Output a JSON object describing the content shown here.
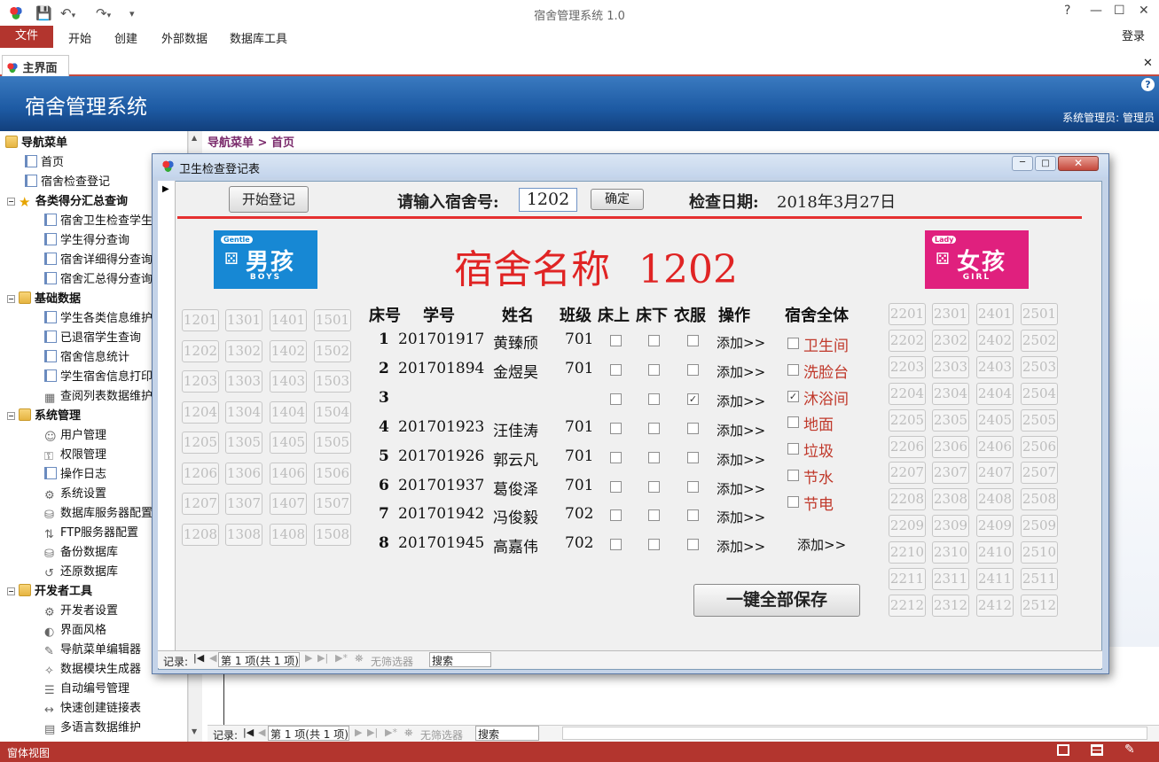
{
  "app": {
    "title": "宿舍管理系统 1.0",
    "login": "登录",
    "accent_color": "#b3352e"
  },
  "ribbon": {
    "file_tab": "文件",
    "tabs": [
      "开始",
      "创建",
      "外部数据",
      "数据库工具"
    ]
  },
  "doc_tab": {
    "label": "主界面"
  },
  "banner": {
    "title": "宿舍管理系统",
    "user": "系统管理员: 管理员"
  },
  "nav": {
    "items": [
      {
        "label": "导航菜单",
        "kind": "root",
        "icon": "folder-icon"
      },
      {
        "label": "首页",
        "kind": "leaf",
        "icon": "page-icon"
      },
      {
        "label": "宿舍检查登记",
        "kind": "leaf",
        "icon": "page-icon"
      },
      {
        "label": "各类得分汇总查询",
        "kind": "group",
        "icon": "star-icon"
      },
      {
        "label": "宿舍卫生检查学生",
        "kind": "sub",
        "icon": "page-icon"
      },
      {
        "label": "学生得分查询",
        "kind": "sub",
        "icon": "page-icon"
      },
      {
        "label": "宿舍详细得分查询",
        "kind": "sub",
        "icon": "page-icon"
      },
      {
        "label": "宿舍汇总得分查询",
        "kind": "sub",
        "icon": "page-icon"
      },
      {
        "label": "基础数据",
        "kind": "group",
        "icon": "folder-icon"
      },
      {
        "label": "学生各类信息维护",
        "kind": "sub",
        "icon": "page-icon"
      },
      {
        "label": "已退宿学生查询",
        "kind": "sub",
        "icon": "page-icon"
      },
      {
        "label": "宿舍信息统计",
        "kind": "sub",
        "icon": "page-icon"
      },
      {
        "label": "学生宿舍信息打印",
        "kind": "sub",
        "icon": "page-icon"
      },
      {
        "label": "查阅列表数据维护",
        "kind": "sub",
        "icon": "table-icon"
      },
      {
        "label": "系统管理",
        "kind": "group",
        "icon": "folder-icon"
      },
      {
        "label": "用户管理",
        "kind": "sub",
        "icon": "users-icon"
      },
      {
        "label": "权限管理",
        "kind": "sub",
        "icon": "lock-icon"
      },
      {
        "label": "操作日志",
        "kind": "sub",
        "icon": "page-icon"
      },
      {
        "label": "系统设置",
        "kind": "sub",
        "icon": "settings-icon"
      },
      {
        "label": "数据库服务器配置",
        "kind": "sub",
        "icon": "database-icon"
      },
      {
        "label": "FTP服务器配置",
        "kind": "sub",
        "icon": "ftp-icon"
      },
      {
        "label": "备份数据库",
        "kind": "sub",
        "icon": "backup-icon"
      },
      {
        "label": "还原数据库",
        "kind": "sub",
        "icon": "restore-icon"
      },
      {
        "label": "开发者工具",
        "kind": "group",
        "icon": "folder-icon"
      },
      {
        "label": "开发者设置",
        "kind": "sub",
        "icon": "dev-settings-icon"
      },
      {
        "label": "界面风格",
        "kind": "sub",
        "icon": "palette-icon"
      },
      {
        "label": "导航菜单编辑器",
        "kind": "sub",
        "icon": "edit-icon"
      },
      {
        "label": "数据模块生成器",
        "kind": "sub",
        "icon": "wand-icon"
      },
      {
        "label": "自动编号管理",
        "kind": "sub",
        "icon": "list-icon"
      },
      {
        "label": "快速创建链接表",
        "kind": "sub",
        "icon": "link-icon"
      },
      {
        "label": "多语言数据维护",
        "kind": "sub",
        "icon": "language-icon"
      }
    ]
  },
  "breadcrumb": "导航菜单 > 首页",
  "bottom_bar": {
    "record_label": "记录:",
    "position": "第 1 项(共 1 项)",
    "filter": "无筛选器",
    "search": "搜索"
  },
  "status": {
    "text": "窗体视图"
  },
  "dialog": {
    "title": "卫生检查登记表",
    "start_button": "开始登记",
    "dorm_prompt": "请输入宿舍号:",
    "dorm_value": "1202",
    "confirm_button": "确定",
    "date_label": "检查日期:",
    "date_value": "2018年3月27日",
    "heading_label": "宿舍名称",
    "heading_value": "1202",
    "boys_logo": {
      "main": "男孩",
      "sub": "BOYS",
      "tag": "Gentle"
    },
    "girls_logo": {
      "main": "女孩",
      "sub": "GIRL",
      "tag": "Lady"
    },
    "columns": [
      "床号",
      "学号",
      "姓名",
      "班级",
      "床上",
      "床下",
      "衣服",
      "操作"
    ],
    "whole_dorm_header": "宿舍全体",
    "rows": [
      {
        "bed": "1",
        "id": "201701917",
        "name": "黄臻颀",
        "class": "701",
        "bed_up": false,
        "bed_down": false,
        "clothes": false,
        "action": "添加>>"
      },
      {
        "bed": "2",
        "id": "201701894",
        "name": "金煜昊",
        "class": "701",
        "bed_up": false,
        "bed_down": false,
        "clothes": false,
        "action": "添加>>"
      },
      {
        "bed": "3",
        "id": "",
        "name": "",
        "class": "",
        "bed_up": false,
        "bed_down": false,
        "clothes": true,
        "action": "添加>>"
      },
      {
        "bed": "4",
        "id": "201701923",
        "name": "汪佳涛",
        "class": "701",
        "bed_up": false,
        "bed_down": false,
        "clothes": false,
        "action": "添加>>"
      },
      {
        "bed": "5",
        "id": "201701926",
        "name": "郭云凡",
        "class": "701",
        "bed_up": false,
        "bed_down": false,
        "clothes": false,
        "action": "添加>>"
      },
      {
        "bed": "6",
        "id": "201701937",
        "name": "葛俊泽",
        "class": "701",
        "bed_up": false,
        "bed_down": false,
        "clothes": false,
        "action": "添加>>"
      },
      {
        "bed": "7",
        "id": "201701942",
        "name": "冯俊毅",
        "class": "702",
        "bed_up": false,
        "bed_down": false,
        "clothes": false,
        "action": "添加>>"
      },
      {
        "bed": "8",
        "id": "201701945",
        "name": "高嘉伟",
        "class": "702",
        "bed_up": false,
        "bed_down": false,
        "clothes": false,
        "action": "添加>>"
      }
    ],
    "areas": [
      {
        "label": "卫生间",
        "checked": false
      },
      {
        "label": "洗脸台",
        "checked": false
      },
      {
        "label": "沐浴间",
        "checked": true
      },
      {
        "label": "地面",
        "checked": false
      },
      {
        "label": "垃圾",
        "checked": false
      },
      {
        "label": "节水",
        "checked": false
      },
      {
        "label": "节电",
        "checked": false
      }
    ],
    "areas_action": "添加>>",
    "save_button": "一键全部保存",
    "left_rooms": [
      [
        "1201",
        "1301",
        "1401",
        "1501"
      ],
      [
        "1202",
        "1302",
        "1402",
        "1502"
      ],
      [
        "1203",
        "1303",
        "1403",
        "1503"
      ],
      [
        "1204",
        "1304",
        "1404",
        "1504"
      ],
      [
        "1205",
        "1305",
        "1405",
        "1505"
      ],
      [
        "1206",
        "1306",
        "1406",
        "1506"
      ],
      [
        "1207",
        "1307",
        "1407",
        "1507"
      ],
      [
        "1208",
        "1308",
        "1408",
        "1508"
      ]
    ],
    "right_rooms": [
      [
        "2201",
        "2301",
        "2401",
        "2501"
      ],
      [
        "2202",
        "2302",
        "2402",
        "2502"
      ],
      [
        "2203",
        "2303",
        "2403",
        "2503"
      ],
      [
        "2204",
        "2304",
        "2404",
        "2504"
      ],
      [
        "2205",
        "2305",
        "2405",
        "2505"
      ],
      [
        "2206",
        "2306",
        "2406",
        "2506"
      ],
      [
        "2207",
        "2307",
        "2407",
        "2507"
      ],
      [
        "2208",
        "2308",
        "2408",
        "2508"
      ],
      [
        "2209",
        "2309",
        "2409",
        "2509"
      ],
      [
        "2210",
        "2310",
        "2410",
        "2510"
      ],
      [
        "2211",
        "2311",
        "2411",
        "2511"
      ],
      [
        "2212",
        "2312",
        "2412",
        "2512"
      ]
    ],
    "record_bar": {
      "record_label": "记录:",
      "position": "第 1 项(共 1 项)",
      "filter": "无筛选器",
      "search": "搜索"
    }
  }
}
